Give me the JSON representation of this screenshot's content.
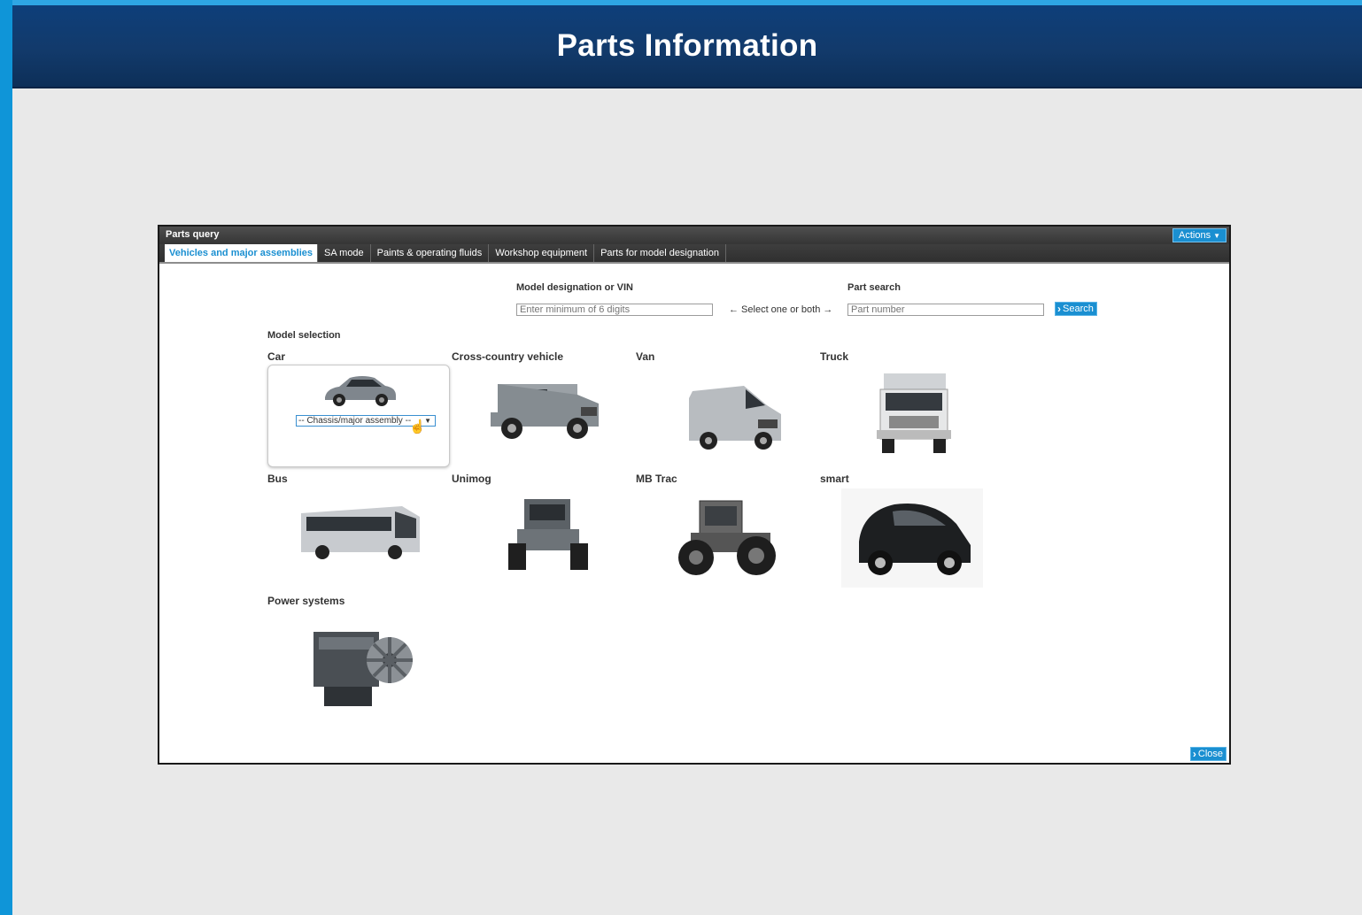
{
  "header": {
    "title": "Parts Information"
  },
  "panel": {
    "title": "Parts query",
    "actions_label": "Actions",
    "tabs": [
      {
        "label": "Vehicles and major assemblies",
        "active": true
      },
      {
        "label": "SA mode",
        "active": false
      },
      {
        "label": "Paints & operating fluids",
        "active": false
      },
      {
        "label": "Workshop equipment",
        "active": false
      },
      {
        "label": "Parts for model designation",
        "active": false
      }
    ],
    "model_designation": {
      "label": "Model designation or VIN",
      "placeholder": "Enter minimum of 6 digits"
    },
    "select_hint": "← Select one or both →",
    "part_search": {
      "label": "Part search",
      "placeholder": "Part number",
      "button": "Search"
    },
    "model_selection": {
      "title": "Model selection",
      "chassis_select": "-- Chassis/major assembly --",
      "categories": [
        "Car",
        "Cross-country vehicle",
        "Van",
        "Truck",
        "Bus",
        "Unimog",
        "MB Trac",
        "smart",
        "Power systems"
      ]
    },
    "close_label": "Close"
  },
  "colors": {
    "accent": "#1a8fd1",
    "header_bg": "#123a6b",
    "side_bar": "#0f95d8"
  }
}
